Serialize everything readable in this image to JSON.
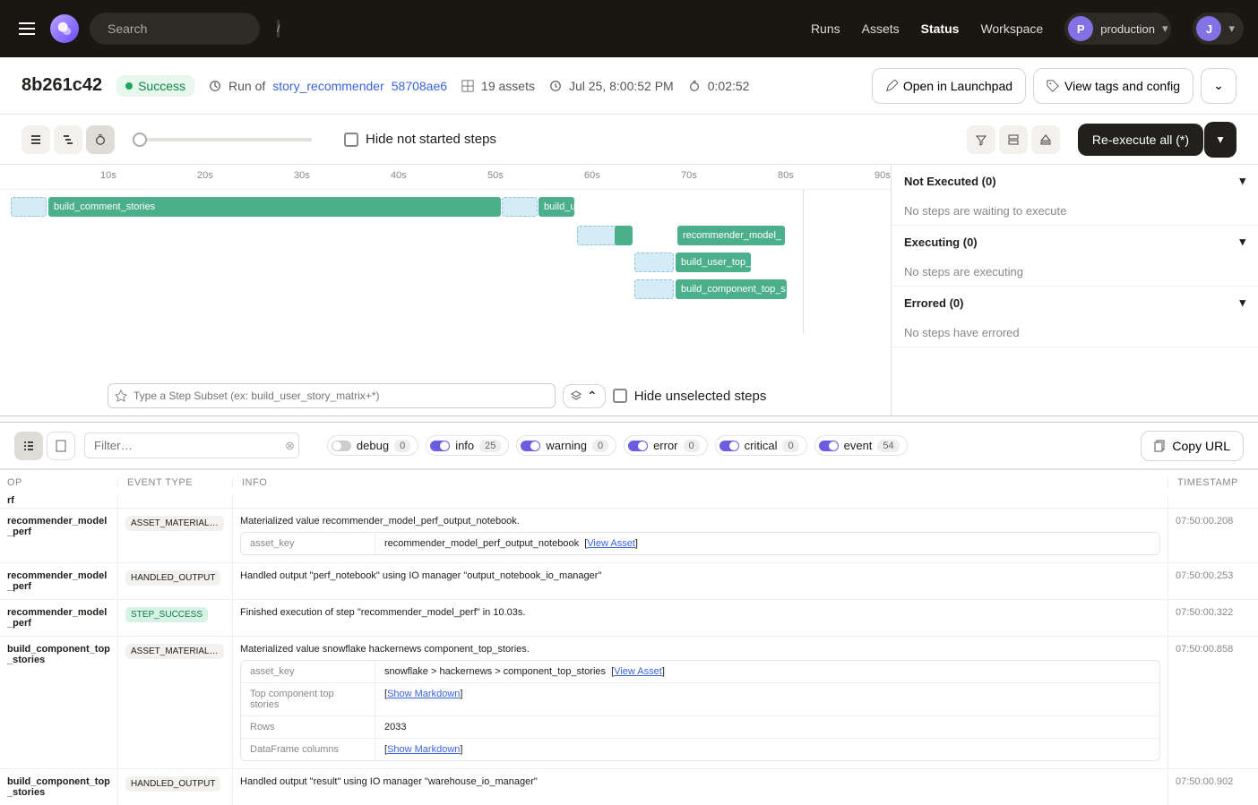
{
  "header": {
    "search_placeholder": "Search",
    "search_key": "/",
    "nav": [
      "Runs",
      "Assets",
      "Status",
      "Workspace"
    ],
    "nav_active": "Status",
    "env_badge": "P",
    "env_name": "production",
    "avatar": "J"
  },
  "subheader": {
    "run_id": "8b261c42",
    "status": "Success",
    "run_of_prefix": "Run of ",
    "job_name": "story_recommender",
    "snapshot": "58708ae6",
    "assets": "19 assets",
    "timestamp": "Jul 25, 8:00:52 PM",
    "duration": "0:02:52",
    "open_launchpad": "Open in Launchpad",
    "view_tags": "View tags and config"
  },
  "toolbar": {
    "hide_not_started": "Hide not started steps",
    "reexecute": "Re-execute all (*)"
  },
  "axis": [
    "10s",
    "20s",
    "30s",
    "40s",
    "50s",
    "60s",
    "70s",
    "80s",
    "90s"
  ],
  "gantt_bars": [
    {
      "label": "build_comment_stories"
    },
    {
      "label": "build_u"
    },
    {
      "label": "recommender_model_"
    },
    {
      "label": "build_user_top_"
    },
    {
      "label": "build_component_top_s"
    }
  ],
  "subset_placeholder": "Type a Step Subset (ex: build_user_story_matrix+*)",
  "hide_unselected": "Hide unselected steps",
  "side": {
    "not_exec_h": "Not Executed (0)",
    "not_exec_b": "No steps are waiting to execute",
    "exec_h": "Executing (0)",
    "exec_b": "No steps are executing",
    "err_h": "Errored (0)",
    "err_b": "No steps have errored"
  },
  "log": {
    "filter_placeholder": "Filter…",
    "copy": "Copy URL",
    "levels": [
      {
        "name": "debug",
        "count": "0",
        "on": false
      },
      {
        "name": "info",
        "count": "25",
        "on": true
      },
      {
        "name": "warning",
        "count": "0",
        "on": true
      },
      {
        "name": "error",
        "count": "0",
        "on": true
      },
      {
        "name": "critical",
        "count": "0",
        "on": true
      },
      {
        "name": "event",
        "count": "54",
        "on": true
      }
    ]
  },
  "columns": {
    "op": "OP",
    "type": "EVENT TYPE",
    "info": "INFO",
    "ts": "TIMESTAMP"
  },
  "rows": [
    {
      "op": "recommender_model_perf",
      "type": "ASSET_MATERIALIZAT…",
      "info": "Materialized value recommender_model_perf_output_notebook.",
      "kv": [
        {
          "k": "asset_key",
          "v": "recommender_model_perf_output_notebook",
          "link": "View Asset"
        }
      ],
      "ts": "07:50:00.208"
    },
    {
      "op": "recommender_model_perf",
      "type": "HANDLED_OUTPUT",
      "info": "Handled output \"perf_notebook\" using IO manager \"output_notebook_io_manager\"",
      "ts": "07:50:00.253"
    },
    {
      "op": "recommender_model_perf",
      "type": "STEP_SUCCESS",
      "success": true,
      "info": "Finished execution of step \"recommender_model_perf\" in 10.03s.",
      "ts": "07:50:00.322"
    },
    {
      "op": "build_component_top_stories",
      "type": "ASSET_MATERIALIZAT…",
      "info": "Materialized value snowflake hackernews component_top_stories.",
      "kv": [
        {
          "k": "asset_key",
          "v": "snowflake > hackernews > component_top_stories",
          "link": "View Asset"
        },
        {
          "k": "Top component top stories",
          "link": "Show Markdown"
        },
        {
          "k": "Rows",
          "v": "2033"
        },
        {
          "k": "DataFrame columns",
          "link": "Show Markdown"
        }
      ],
      "ts": "07:50:00.858"
    },
    {
      "op": "build_component_top_stories",
      "type": "HANDLED_OUTPUT",
      "info": "Handled output \"result\" using IO manager \"warehouse_io_manager\"",
      "ts": "07:50:00.902"
    }
  ]
}
